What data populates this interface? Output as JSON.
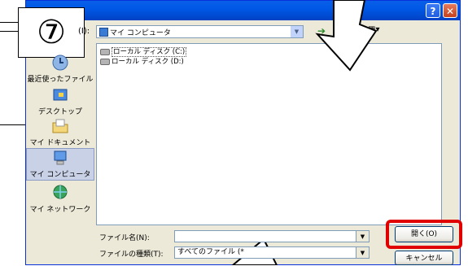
{
  "step_badge": "⑦",
  "titlebar": {
    "help_label": "?",
    "close_label": "✕"
  },
  "lookin": {
    "label": "(I):",
    "value": "マイ コンピュータ"
  },
  "places": [
    {
      "label": "最近使ったファイル"
    },
    {
      "label": "デスクトップ"
    },
    {
      "label": "マイ ドキュメント"
    },
    {
      "label": "マイ コンピュータ"
    },
    {
      "label": "マイ ネットワーク"
    }
  ],
  "files": [
    {
      "label": "ローカル ディスク (C:)"
    },
    {
      "label": "ローカル ディスク (D:)"
    }
  ],
  "filename": {
    "label": "ファイル名(N):",
    "value": ""
  },
  "filetype": {
    "label": "ファイルの種類(T):",
    "value": "すべてのファイル (*"
  },
  "buttons": {
    "open": "開く(O)",
    "cancel": "キャンセル"
  },
  "toolbar": {
    "views_label": "▦▾"
  }
}
